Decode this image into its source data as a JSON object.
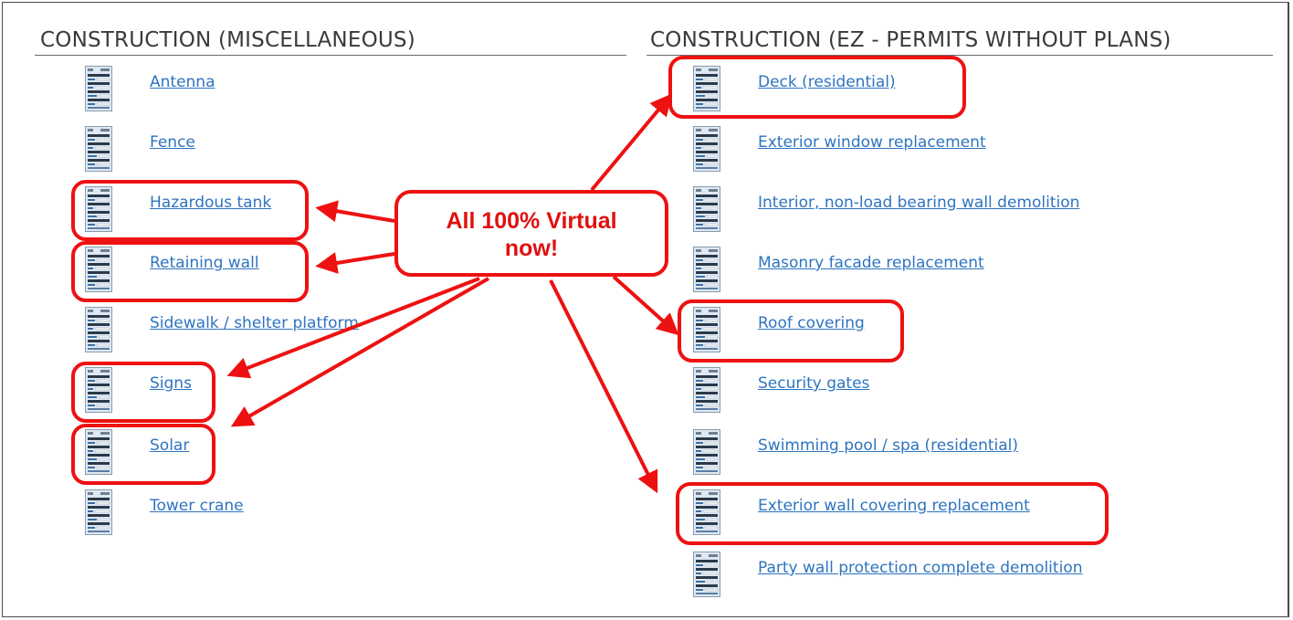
{
  "left_column": {
    "header": "CONSTRUCTION (MISCELLANEOUS)",
    "items": [
      {
        "label": "Antenna",
        "icon": "form-icon",
        "highlighted": false
      },
      {
        "label": "Fence",
        "icon": "form-icon",
        "highlighted": false
      },
      {
        "label": "Hazardous tank",
        "icon": "form-icon",
        "highlighted": true
      },
      {
        "label": "Retaining wall",
        "icon": "form-icon",
        "highlighted": true
      },
      {
        "label": "Sidewalk / shelter platform",
        "icon": "form-icon",
        "highlighted": false
      },
      {
        "label": "Signs",
        "icon": "form-icon",
        "highlighted": true
      },
      {
        "label": "Solar",
        "icon": "form-icon",
        "highlighted": true
      },
      {
        "label": "Tower crane",
        "icon": "form-icon",
        "highlighted": false
      }
    ]
  },
  "right_column": {
    "header": "CONSTRUCTION (EZ - PERMITS WITHOUT PLANS)",
    "items": [
      {
        "label": "Deck (residential)",
        "icon": "form-icon",
        "highlighted": true
      },
      {
        "label": "Exterior window replacement",
        "icon": "form-icon",
        "highlighted": false
      },
      {
        "label": "Interior, non-load bearing wall demolition",
        "icon": "form-icon",
        "highlighted": false
      },
      {
        "label": "Masonry facade replacement",
        "icon": "form-icon",
        "highlighted": false
      },
      {
        "label": "Roof covering",
        "icon": "form-icon",
        "highlighted": true
      },
      {
        "label": "Security gates",
        "icon": "form-icon",
        "highlighted": false
      },
      {
        "label": "Swimming pool / spa (residential)",
        "icon": "form-icon",
        "highlighted": false
      },
      {
        "label": "Exterior wall covering replacement",
        "icon": "form-icon",
        "highlighted": true
      },
      {
        "label": "Party wall protection complete demolition",
        "icon": "form-icon",
        "highlighted": false
      }
    ]
  },
  "callout": {
    "line1": "All 100% Virtual",
    "line2": "now!"
  },
  "colors": {
    "link": "#2e74c0",
    "annotation_red": "#ee1111",
    "header_text": "#3a3a3a"
  }
}
